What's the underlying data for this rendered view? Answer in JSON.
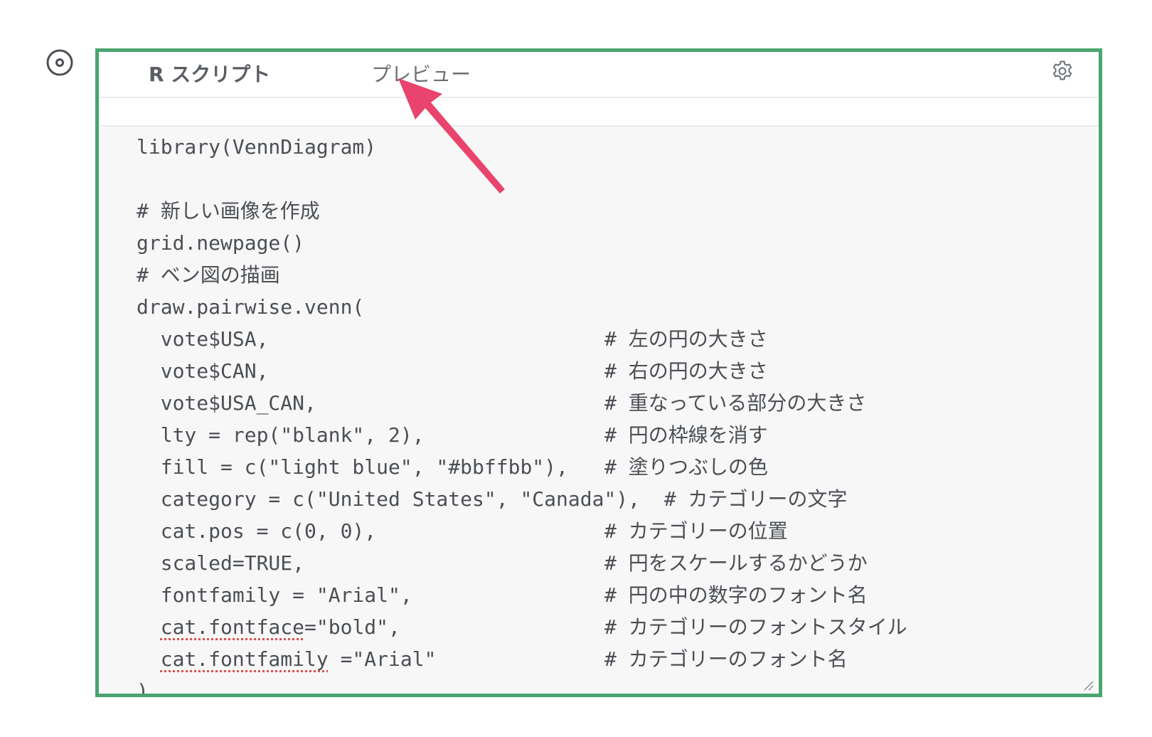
{
  "colors": {
    "frame_border": "#4aa46f",
    "arrow": "#e8446d",
    "code_background": "#f7f7f7",
    "code_text": "#4b4f54",
    "spellcheck": "#e05050"
  },
  "icons": {
    "left": "radio-target-icon",
    "settings": "gear-icon",
    "resize": "resize-handle-icon",
    "annotation": "arrow-icon"
  },
  "tabs": {
    "script_label": "R スクリプト",
    "preview_label": "プレビュー"
  },
  "code": {
    "lines": [
      {
        "text": "library(VennDiagram)",
        "comment": ""
      },
      {
        "text": "",
        "comment": ""
      },
      {
        "text": "# 新しい画像を作成",
        "comment": ""
      },
      {
        "text": "grid.newpage()",
        "comment": ""
      },
      {
        "text": "# ベン図の描画",
        "comment": ""
      },
      {
        "text": "draw.pairwise.venn(",
        "comment": ""
      },
      {
        "text": "  vote$USA,",
        "comment": "# 左の円の大きさ"
      },
      {
        "text": "  vote$CAN,",
        "comment": "# 右の円の大きさ"
      },
      {
        "text": "  vote$USA_CAN,",
        "comment": "# 重なっている部分の大きさ"
      },
      {
        "text": "  lty = rep(\"blank\", 2),",
        "comment": "# 円の枠線を消す"
      },
      {
        "text": "  fill = c(\"light blue\", \"#bbffbb\"),",
        "comment": "# 塗りつぶしの色"
      },
      {
        "text": "  category = c(\"United States\", \"Canada\"),  # カテゴリーの文字",
        "comment": ""
      },
      {
        "text": "  cat.pos = c(0, 0),",
        "comment": "# カテゴリーの位置"
      },
      {
        "text": "  scaled=TRUE,",
        "comment": "# 円をスケールするかどうか"
      },
      {
        "text": "  fontfamily = \"Arial\",",
        "comment": "# 円の中の数字のフォント名"
      },
      {
        "text": "  ",
        "spell": "cat.fontface",
        "rest": "=\"bold\",",
        "comment": "# カテゴリーのフォントスタイル"
      },
      {
        "text": "  ",
        "spell": "cat.fontfamily",
        "rest": " =\"Arial\"",
        "comment": "# カテゴリーのフォント名"
      },
      {
        "text": ")",
        "comment": ""
      }
    ]
  }
}
